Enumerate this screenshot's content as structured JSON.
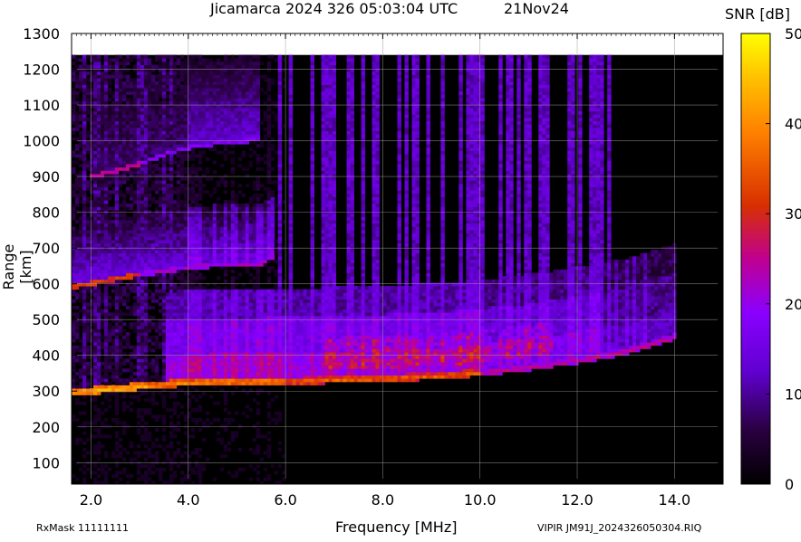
{
  "header": {
    "title": "Jicamarca 2024 326 05:03:04 UTC",
    "date": "21Nov24"
  },
  "colorbar": {
    "title": "SNR [dB]",
    "range": [
      0,
      50
    ],
    "ticks": [
      0,
      10,
      20,
      30,
      40,
      50
    ]
  },
  "footer": {
    "left": "RxMask 11111111",
    "right": "VIPIR  JM91J_2024326050304.RIQ"
  },
  "chart_data": {
    "type": "heatmap",
    "title": "Jicamarca 2024 326 05:03:04 UTC",
    "xlabel": "Frequency [MHz]",
    "ylabel": "Range [km]",
    "xlim": [
      1.6,
      15.0
    ],
    "ylim": [
      40,
      1300
    ],
    "xticks": [
      2.0,
      4.0,
      6.0,
      8.0,
      10.0,
      12.0,
      14.0
    ],
    "xtick_labels": [
      "2.0",
      "4.0",
      "6.0",
      "8.0",
      "10.0",
      "12.0",
      "14.0"
    ],
    "yticks": [
      100,
      200,
      300,
      400,
      500,
      600,
      700,
      800,
      900,
      1000,
      1100,
      1200,
      1300
    ],
    "grid": true,
    "data_range_top": 1240,
    "traces": [
      {
        "name": "O-trace",
        "x": [
          1.6,
          2.0,
          2.5,
          3.0,
          3.5,
          4.0,
          4.5,
          5.0,
          5.5,
          6.0,
          7.0,
          8.0,
          9.0,
          10.0,
          11.0,
          12.0,
          13.0,
          14.0
        ],
        "y": [
          295,
          300,
          305,
          312,
          318,
          322,
          325,
          326,
          326,
          327,
          330,
          335,
          340,
          350,
          365,
          385,
          410,
          450
        ]
      },
      {
        "name": "second hop",
        "x": [
          1.6,
          2.0,
          2.5,
          3.0,
          3.5,
          4.0,
          4.5,
          5.0,
          5.5,
          5.8
        ],
        "y": [
          590,
          600,
          612,
          625,
          635,
          645,
          650,
          652,
          655,
          680
        ]
      },
      {
        "name": "third hop",
        "x": [
          2.0,
          2.5,
          3.0,
          3.5,
          4.0,
          4.5,
          5.0,
          5.5
        ],
        "y": [
          900,
          915,
          935,
          960,
          980,
          990,
          995,
          1005
        ]
      }
    ],
    "colormap": [
      "#000000",
      "#2a0040",
      "#7800ff",
      "#c000a0",
      "#e05000",
      "#ffa000",
      "#ffff00"
    ],
    "zlabel": "SNR [dB]",
    "zlim": [
      0,
      50
    ]
  }
}
